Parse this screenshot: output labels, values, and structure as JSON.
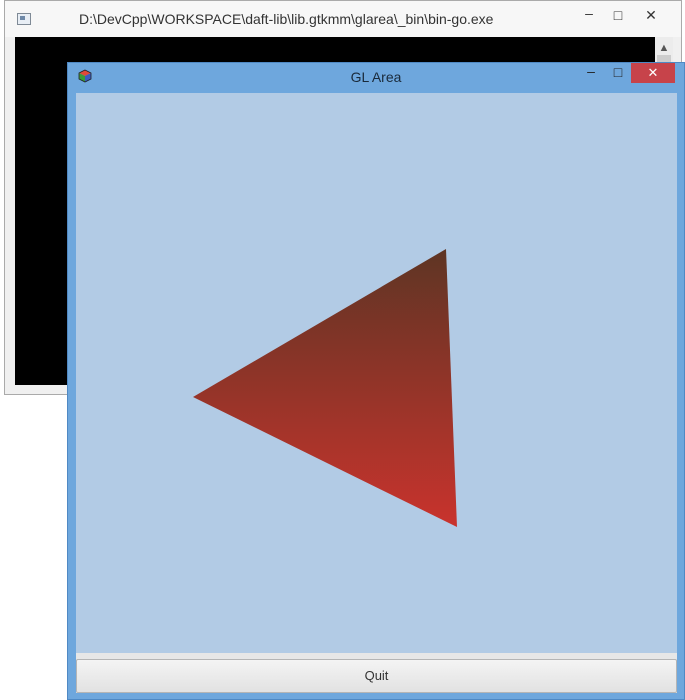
{
  "console_window": {
    "title": "D:\\DevCpp\\WORKSPACE\\daft-lib\\lib.gtkmm\\glarea\\_bin\\bin-go.exe",
    "minimize": "–",
    "maximize": "□",
    "close": "✕",
    "icon": "console-app-icon"
  },
  "gl_window": {
    "title": "GL Area",
    "minimize": "–",
    "maximize": "□",
    "close": "✕",
    "icon": "gtk-cube-icon",
    "quit_label": "Quit",
    "colors": {
      "canvas_background": "#b2cbe5",
      "triangle_top": "#5e3524",
      "triangle_bottom": "#c9332d",
      "title_bar": "#6ea7dd",
      "close_button": "#c7434a"
    }
  }
}
